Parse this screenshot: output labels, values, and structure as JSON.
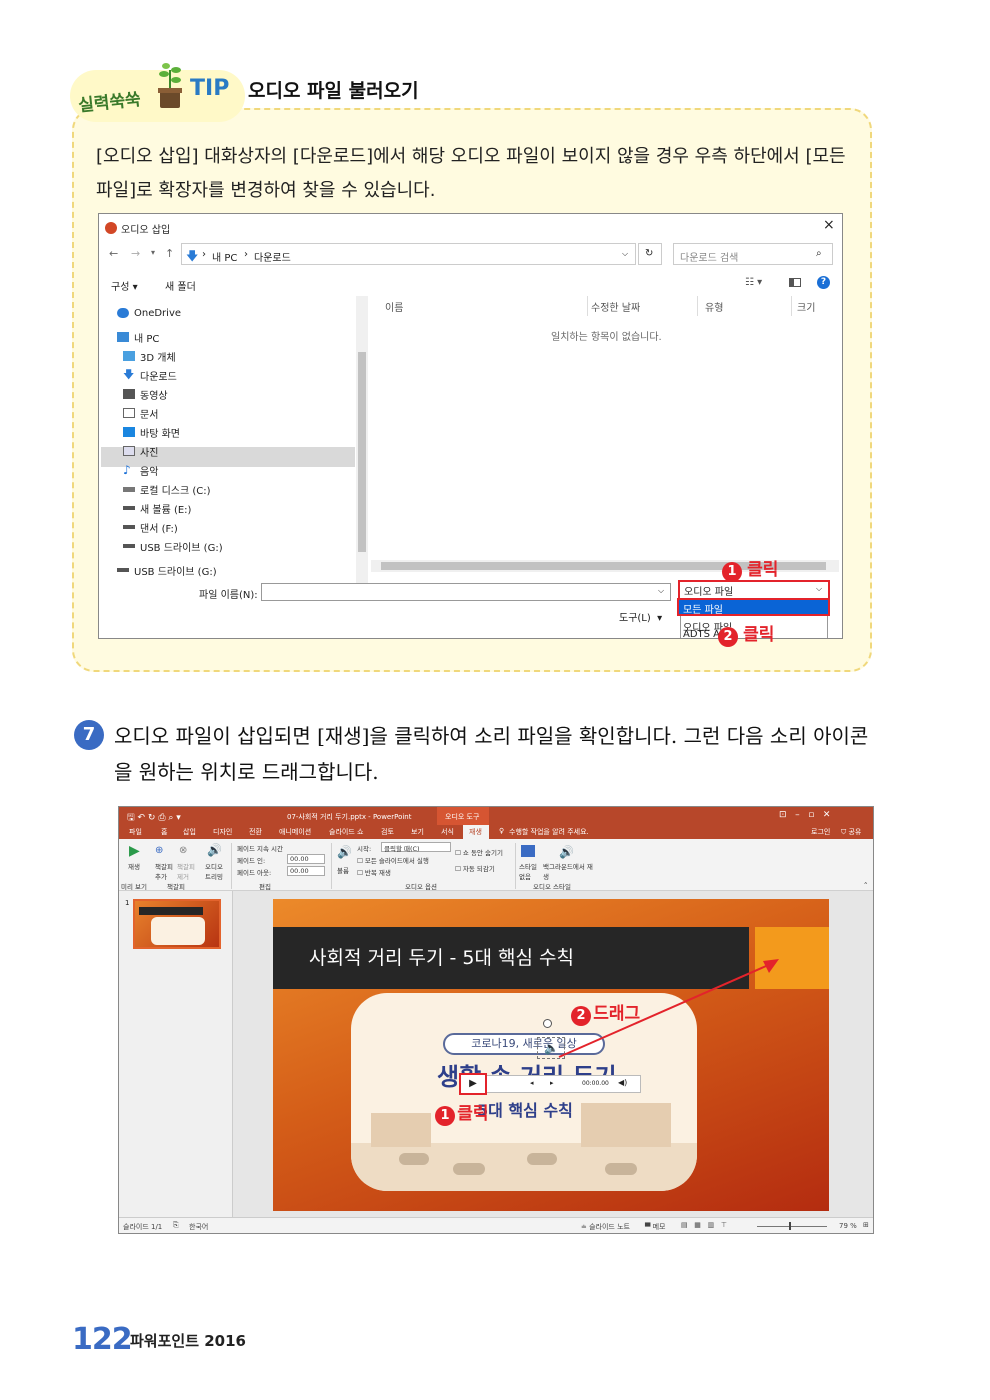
{
  "tip": {
    "badge": "실력쑥쑥",
    "tag": "TIP",
    "title": "오디오 파일 불러오기",
    "body": "[오디오 삽입] 대화상자의 [다운로드]에서 해당 오디오 파일이 보이지 않을 경우 우측 하단에서 [모든 파일]로 확장자를 변경하여 찾을 수 있습니다."
  },
  "dialog": {
    "title": "오디오 삽입",
    "close": "×",
    "path": [
      "내 PC",
      "다운로드"
    ],
    "search_placeholder": "다운로드 검색",
    "toolbar": {
      "organize": "구성 ▾",
      "new_folder": "새 폴더"
    },
    "sidebar": [
      {
        "label": "OneDrive",
        "icon": "cloud-icon"
      },
      {
        "label": "내 PC",
        "icon": "pc-icon"
      },
      {
        "label": "3D 개체",
        "icon": "cube-icon"
      },
      {
        "label": "다운로드",
        "icon": "download-icon",
        "selected": true
      },
      {
        "label": "동영상",
        "icon": "video-icon"
      },
      {
        "label": "문서",
        "icon": "document-icon"
      },
      {
        "label": "바탕 화면",
        "icon": "desktop-icon"
      },
      {
        "label": "사진",
        "icon": "picture-icon"
      },
      {
        "label": "음악",
        "icon": "music-icon"
      },
      {
        "label": "로컬 디스크 (C:)",
        "icon": "disk-icon"
      },
      {
        "label": "새 볼륨 (E:)",
        "icon": "drive-icon"
      },
      {
        "label": "댄서 (F:)",
        "icon": "drive-icon"
      },
      {
        "label": "USB 드라이브 (G:)",
        "icon": "usb-icon"
      },
      {
        "label": "USB 드라이브 (G:)",
        "icon": "usb-icon"
      }
    ],
    "columns": [
      "이름",
      "수정한 날짜",
      "유형",
      "크기"
    ],
    "empty_message": "일치하는 항목이 없습니다.",
    "filename_label": "파일 이름(N):",
    "filetype_value": "오디오 파일",
    "tools_label": "도구(L)",
    "dropdown_options": [
      "모든 파일",
      "오디오 파일",
      "ADTS Au"
    ],
    "step1": "클릭",
    "step2": "클릭"
  },
  "step7": {
    "number": "7",
    "text": "오디오 파일이 삽입되면 [재생]을 클릭하여 소리 파일을 확인합니다. 그런 다음 소리 아이콘을 원하는 위치로 드래그합니다."
  },
  "ppt": {
    "window_title": "07-사회적 거리 두기.pptx - PowerPoint",
    "context_tab": "오디오 도구",
    "tabs": [
      "파일",
      "홈",
      "삽입",
      "디자인",
      "전환",
      "애니메이션",
      "슬라이드 쇼",
      "검토",
      "보기",
      "서식",
      "재생"
    ],
    "tell_me": "수행할 작업을 알려 주세요.",
    "account": [
      "로그인",
      "공유"
    ],
    "ribbon": {
      "play": "재생",
      "bookmark_add": "책갈피 추가",
      "bookmark_remove": "책갈피 제거",
      "trim": "오디오 트리밍",
      "fade_duration": "페이드 지속 시간",
      "fade_in": "페이드 인:",
      "fade_out": "페이드 아웃:",
      "fade_in_value": "00.00",
      "fade_out_value": "00.00",
      "volume": "볼륨",
      "start": "시작:",
      "start_value": "클릭할 때(C)",
      "play_all_slides": "모든 슬라이드에서 실행",
      "loop": "반복 재생",
      "hide_during_show": "쇼 동안 숨기기",
      "rewind": "자동 되감기",
      "no_style": "스타일 없음",
      "play_in_bg": "백그라운드에서 재생",
      "groups": [
        "미리 보기",
        "책갈피",
        "편집",
        "오디오 옵션",
        "오디오 스타일"
      ]
    },
    "slide_number": "1",
    "slide_title": "사회적 거리 두기 - 5대 핵심 수칙",
    "card_badge": "코로나19, 새로운 일상",
    "card_title": "생활 속 거리 두기",
    "card_sub": "5대 핵심 수칙",
    "player_time": "00:00.00",
    "drag_label": "드래그",
    "click_label": "클릭",
    "status": {
      "slide": "슬라이드 1/1",
      "lang": "한국어",
      "notes": "슬라이드 노트",
      "comments": "메모",
      "zoom": "79 %"
    }
  },
  "footer": {
    "page_number": "122",
    "book_title": "파워포인트 2016"
  }
}
